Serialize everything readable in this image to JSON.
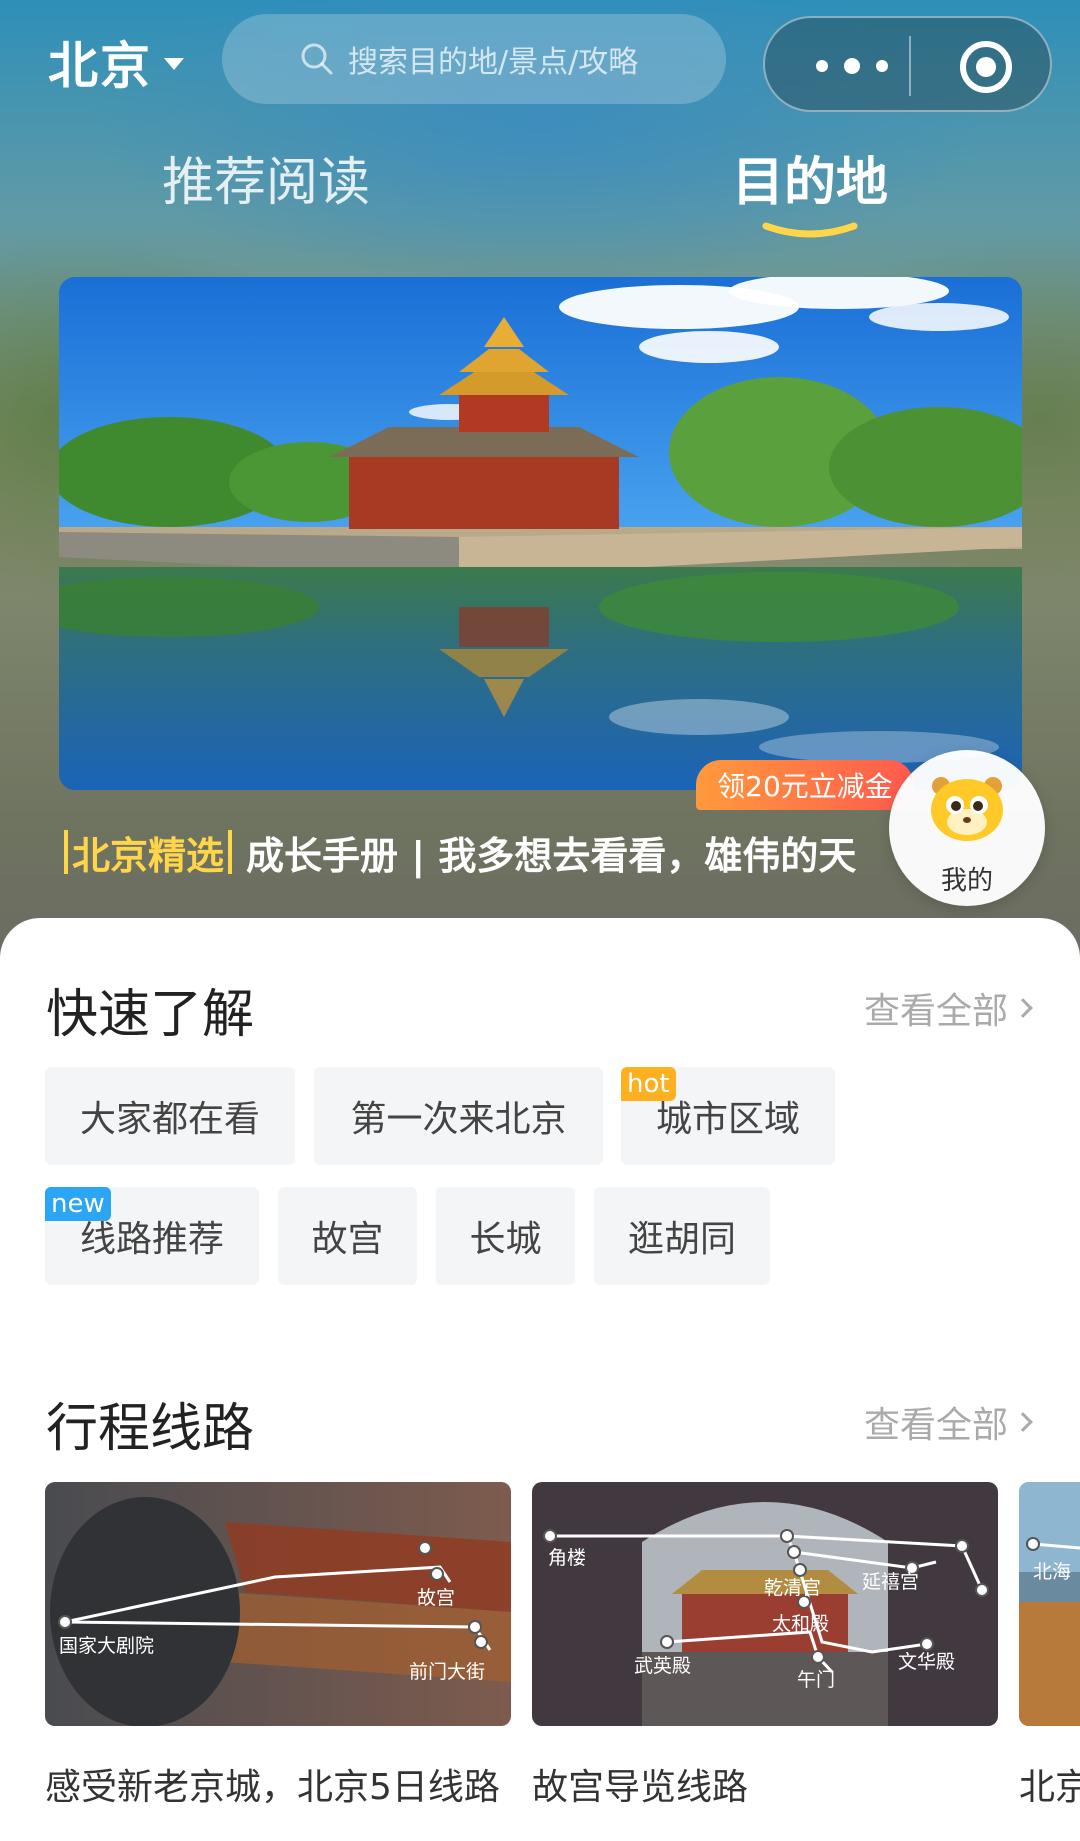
{
  "header": {
    "city": "北京",
    "search_placeholder": "搜索目的地/景点/攻略"
  },
  "tabs": [
    {
      "label": "推荐阅读",
      "active": false
    },
    {
      "label": "目的地",
      "active": true
    }
  ],
  "banner": {
    "tag": "北京精选",
    "headline": "成长手册 | 我多想去看看，雄伟的天",
    "coupon": "领20元立减金",
    "mine_label": "我的"
  },
  "quick": {
    "title": "快速了解",
    "see_all": "查看全部",
    "chips": [
      {
        "label": "大家都在看"
      },
      {
        "label": "第一次来北京"
      },
      {
        "label": "城市区域",
        "badge": "hot"
      },
      {
        "label": "线路推荐",
        "badge": "new"
      },
      {
        "label": "故宫"
      },
      {
        "label": "长城"
      },
      {
        "label": "逛胡同"
      }
    ]
  },
  "routes": {
    "title": "行程线路",
    "see_all": "查看全部",
    "cards": [
      {
        "title": "感受新老京城，北京5日线路",
        "stops": [
          "故宫",
          "国家大剧院",
          "前门大街"
        ]
      },
      {
        "title": "故宫导览线路",
        "stops": [
          "角楼",
          "乾清宫",
          "延禧宫",
          "太和殿",
          "武英殿",
          "午门",
          "文华殿"
        ]
      },
      {
        "title": "北京",
        "stops": [
          "北海"
        ]
      }
    ]
  },
  "colors": {
    "accent_yellow": "#ffd54a",
    "hot_badge": "#ffb020",
    "new_badge": "#2aa6f4",
    "coupon_start": "#ff9a3c",
    "coupon_end": "#ff5a4f"
  }
}
